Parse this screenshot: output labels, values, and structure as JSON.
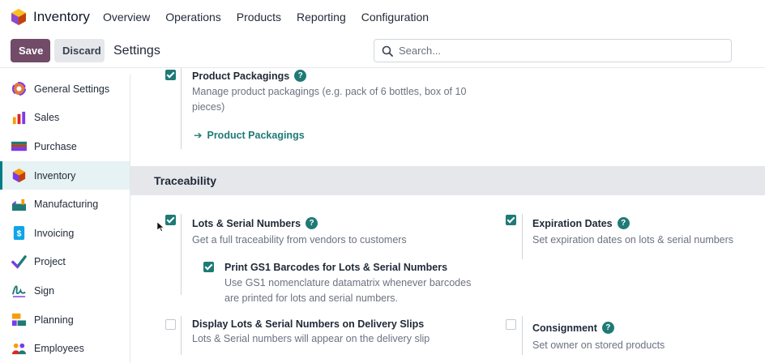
{
  "navbar": {
    "app_name": "Inventory",
    "menu": [
      "Overview",
      "Operations",
      "Products",
      "Reporting",
      "Configuration"
    ]
  },
  "control": {
    "save_label": "Save",
    "discard_label": "Discard",
    "title": "Settings",
    "search_placeholder": "Search..."
  },
  "sidebar": {
    "items": [
      {
        "label": "General Settings",
        "icon": "general-settings-icon"
      },
      {
        "label": "Sales",
        "icon": "sales-icon"
      },
      {
        "label": "Purchase",
        "icon": "purchase-icon"
      },
      {
        "label": "Inventory",
        "icon": "inventory-icon",
        "active": true
      },
      {
        "label": "Manufacturing",
        "icon": "manufacturing-icon"
      },
      {
        "label": "Invoicing",
        "icon": "invoicing-icon"
      },
      {
        "label": "Project",
        "icon": "project-icon"
      },
      {
        "label": "Sign",
        "icon": "sign-icon"
      },
      {
        "label": "Planning",
        "icon": "planning-icon"
      },
      {
        "label": "Employees",
        "icon": "employees-icon"
      }
    ]
  },
  "packaging": {
    "title": "Product Packagings",
    "desc": "Manage product packagings (e.g. pack of 6 bottles, box of 10 pieces)",
    "link": "Product Packagings"
  },
  "traceability": {
    "heading": "Traceability",
    "lots": {
      "title": "Lots & Serial Numbers",
      "desc": "Get a full traceability from vendors to customers",
      "checked": true
    },
    "gs1": {
      "title": "Print GS1 Barcodes for Lots & Serial Numbers",
      "desc": "Use GS1 nomenclature datamatrix whenever barcodes are printed for lots and serial numbers.",
      "checked": true
    },
    "delivery": {
      "title": "Display Lots & Serial Numbers on Delivery Slips",
      "desc": "Lots & Serial numbers will appear on the delivery slip",
      "checked": false
    },
    "expiration": {
      "title": "Expiration Dates",
      "desc": "Set expiration dates on lots & serial numbers",
      "checked": true
    },
    "consignment": {
      "title": "Consignment",
      "desc": "Set owner on stored products",
      "checked": false
    }
  },
  "colors": {
    "brand": "#714b67",
    "accent": "#1f7a76",
    "active_bg": "#e6f2f3"
  }
}
